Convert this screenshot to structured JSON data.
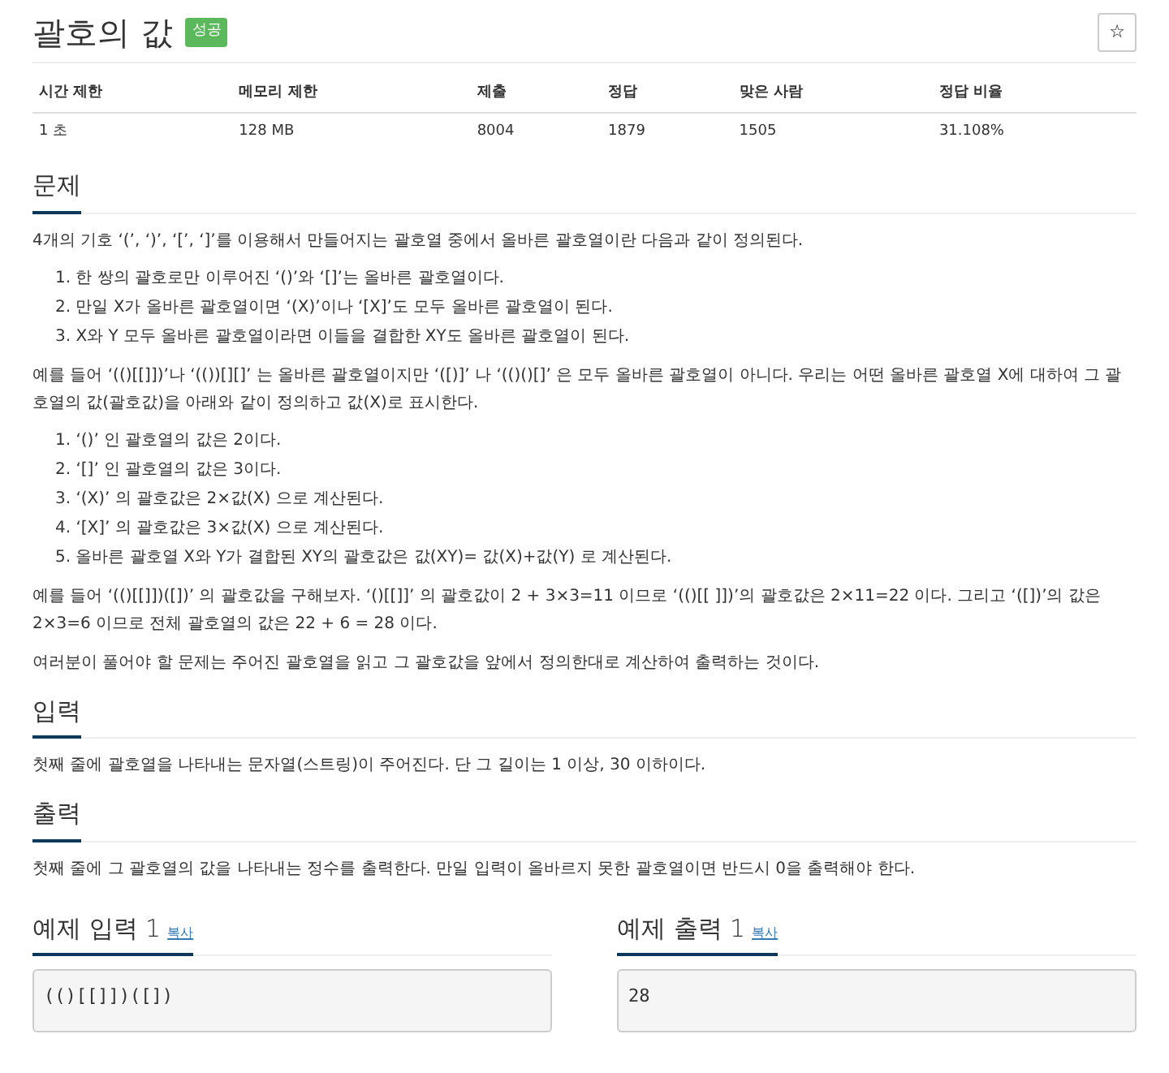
{
  "title": "괄호의 값",
  "badge": "성공",
  "star_button": "☆",
  "stats": {
    "columns": [
      "시간 제한",
      "메모리 제한",
      "제출",
      "정답",
      "맞은 사람",
      "정답 비율"
    ],
    "row": [
      "1 초",
      "128 MB",
      "8004",
      "1879",
      "1505",
      "31.108%"
    ]
  },
  "sections": [
    {
      "heading": "문제",
      "content": [
        {
          "kind": "p",
          "text": "4개의 기호 ‘(’, ‘)’, ‘[’, ‘]’를 이용해서 만들어지는 괄호열 중에서 올바른 괄호열이란 다음과 같이 정의된다."
        },
        {
          "kind": "ol",
          "items": [
            {
              "marker": "1.",
              "text": "한 쌍의 괄호로만 이루어진 ‘()’와 ‘[]’는 올바른 괄호열이다."
            },
            {
              "marker": "2.",
              "text": "만일 X가 올바른 괄호열이면 ‘(X)’이나 ‘[X]’도 모두 올바른 괄호열이 된다."
            },
            {
              "marker": "3.",
              "text": "X와 Y 모두 올바른 괄호열이라면 이들을 결합한 XY도 올바른 괄호열이 된다."
            }
          ]
        },
        {
          "kind": "p",
          "text": "예를 들어 ‘(()[[]])’나 ‘(())[][]’ 는 올바른 괄호열이지만 ‘([)]’ 나 ‘(()()[]’ 은 모두 올바른 괄호열이 아니다. 우리는 어떤 올바른 괄호열 X에 대하여 그 괄호열의 값(괄호값)을 아래와 같이 정의하고 값(X)로 표시한다."
        },
        {
          "kind": "ol",
          "items": [
            {
              "marker": "1.",
              "text": "‘()’ 인 괄호열의 값은 2이다."
            },
            {
              "marker": "2.",
              "text": "‘[]’ 인 괄호열의 값은 3이다."
            },
            {
              "marker": "3.",
              "text": "‘(X)’ 의 괄호값은 2×값(X) 으로 계산된다."
            },
            {
              "marker": "4.",
              "text": "‘[X]’ 의 괄호값은 3×값(X) 으로 계산된다."
            },
            {
              "marker": "5.",
              "text": "올바른 괄호열 X와 Y가 결합된 XY의 괄호값은 값(XY)= 값(X)+값(Y) 로 계산된다."
            }
          ]
        },
        {
          "kind": "p",
          "text": "예를 들어 ‘(()[[]])([])’ 의 괄호값을 구해보자.  ‘()[[]]’ 의 괄호값이 2 + 3×3=11 이므로  ‘(()[[ ]])’의 괄호값은 2×11=22 이다. 그리고  ‘([])’의 값은 2×3=6 이므로 전체 괄호열의 값은 22 + 6 = 28 이다."
        },
        {
          "kind": "p",
          "text": "여러분이 풀어야 할 문제는 주어진 괄호열을 읽고 그 괄호값을 앞에서 정의한대로 계산하여 출력하는 것이다."
        }
      ]
    },
    {
      "heading": "입력",
      "content": [
        {
          "kind": "p",
          "text": "첫째 줄에 괄호열을 나타내는 문자열(스트링)이 주어진다. 단 그 길이는 1 이상, 30 이하이다."
        }
      ]
    },
    {
      "heading": "출력",
      "content": [
        {
          "kind": "p",
          "text": "첫째 줄에 그 괄호열의 값을 나타내는 정수를 출력한다. 만일 입력이 올바르지 못한 괄호열이면 반드시 0을 출력해야 한다."
        }
      ]
    }
  ],
  "samples": [
    {
      "heading": "예제 입력 1",
      "copy": "복사",
      "content": "(()[[]])([])"
    },
    {
      "heading": "예제 출력 1",
      "copy": "복사",
      "content": "28"
    }
  ]
}
